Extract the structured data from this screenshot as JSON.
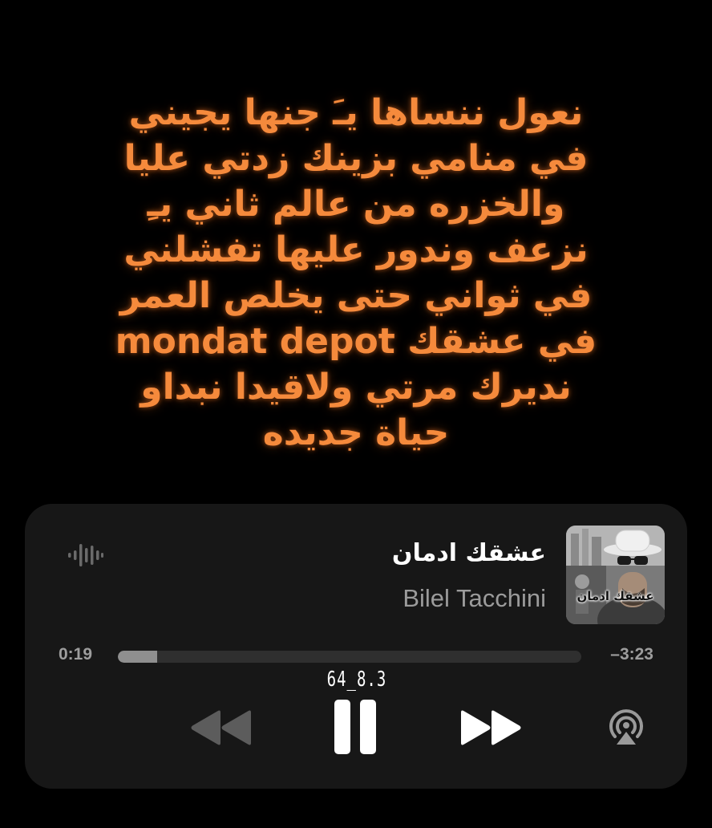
{
  "lyrics": [
    "نعول ننساها يـَ جنها يجيني",
    "في منامي بزينك زدتي عليا",
    "والخزره من عالم ثاني يـِ",
    "نزعف وندور عليها تفشلني",
    "في ثواني حتى يخلص العمر",
    "في عشقك mondat depot",
    "نديرك مرتي ولاقيدا نبداو",
    "حياة جديده"
  ],
  "player": {
    "title": "عشقك ادمان",
    "artist": "Bilel Tacchini",
    "album_art_caption": "عشقك ادمان",
    "time_elapsed": "0:19",
    "time_remaining": "–3:23",
    "progress_fraction": 0.085,
    "overlay_tag": "64_8.3",
    "controls": {
      "rewind_icon": "rewind-icon",
      "pause_icon": "pause-icon",
      "forward_icon": "fast-forward-icon",
      "airplay_icon": "airplay-icon",
      "waveform_icon": "waveform-icon"
    }
  },
  "colors": {
    "lyrics": "#f58a3c",
    "background": "#000000",
    "card": "#171717",
    "title": "#ffffff",
    "artist": "#9b9b9b",
    "progress_track": "#2f2f2f",
    "progress_fill": "#8f8f8f",
    "controls": "#ffffff",
    "controls_dim": "#5c5c5c"
  }
}
